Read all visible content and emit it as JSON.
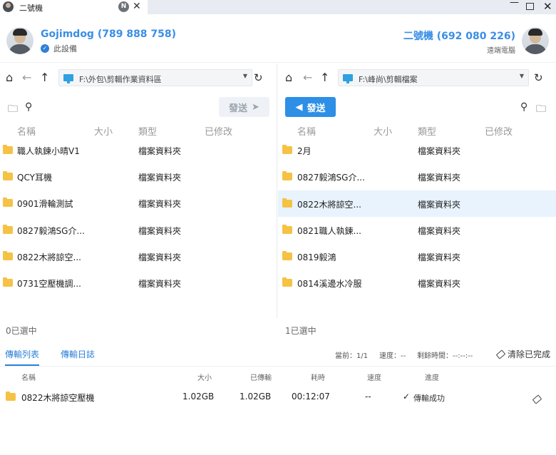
{
  "window": {
    "tab_title": "二號機",
    "tab_badge": "N",
    "close_glyph": "✕",
    "minimize_glyph": "—",
    "close_window_glyph": "✕"
  },
  "local": {
    "name": "Gojimdog (789 888 758)",
    "sub": "此設備"
  },
  "remote": {
    "name": "二號機 (692 080 226)",
    "sub": "遠端電腦"
  },
  "left_pane": {
    "path": "F:\\外包\\剪輯作業資料區",
    "send_label": "發送",
    "columns": [
      "名稱",
      "大小",
      "類型",
      "已修改"
    ],
    "rows": [
      {
        "name": "職人執鍊小晴V1",
        "type": "檔案資料夾"
      },
      {
        "name": "QCY耳機",
        "type": "檔案資料夾"
      },
      {
        "name": "0901滑輪測試",
        "type": "檔案資料夾"
      },
      {
        "name": "0827毅鴻SG介...",
        "type": "檔案資料夾"
      },
      {
        "name": "0822木將諒空...",
        "type": "檔案資料夾"
      },
      {
        "name": "0731空壓機調...",
        "type": "檔案資料夾"
      }
    ],
    "selected_count": "0已選中"
  },
  "right_pane": {
    "path": "F:\\峰尚\\剪輯檔案",
    "send_label": "發送",
    "columns": [
      "名稱",
      "大小",
      "類型",
      "已修改"
    ],
    "rows": [
      {
        "name": "2月",
        "type": "檔案資料夾"
      },
      {
        "name": "0827毅鴻SG介...",
        "type": "檔案資料夾"
      },
      {
        "name": "0822木將諒空...",
        "type": "檔案資料夾"
      },
      {
        "name": "0821職人執鍊...",
        "type": "檔案資料夾"
      },
      {
        "name": "0819毅鴻",
        "type": "檔案資料夾"
      },
      {
        "name": "0814溪邊水冷服",
        "type": "檔案資料夾"
      }
    ],
    "selected_count": "1已選中"
  },
  "bottom": {
    "tab_list": "傳輸列表",
    "tab_log": "傳輸日誌",
    "status_current": "當前：1/1",
    "status_speed": "速度：--",
    "status_remaining": "剩餘時間：--:--:--",
    "clear_label": "清除已完成",
    "columns": {
      "name": "名稱",
      "size": "大小",
      "transferred": "已傳輸",
      "elapsed": "耗時",
      "speed": "速度",
      "progress": "進度"
    },
    "transfer": {
      "name": "0822木將諒空壓機",
      "size": "1.02GB",
      "transferred": "1.02GB",
      "elapsed": "00:12:07",
      "speed": "--",
      "status": "傳輸成功"
    }
  },
  "colors": {
    "accent": "#2d8fe6",
    "name_blue": "#3a8ee6",
    "folder": "#f5c245",
    "success": "#2fa05a"
  }
}
